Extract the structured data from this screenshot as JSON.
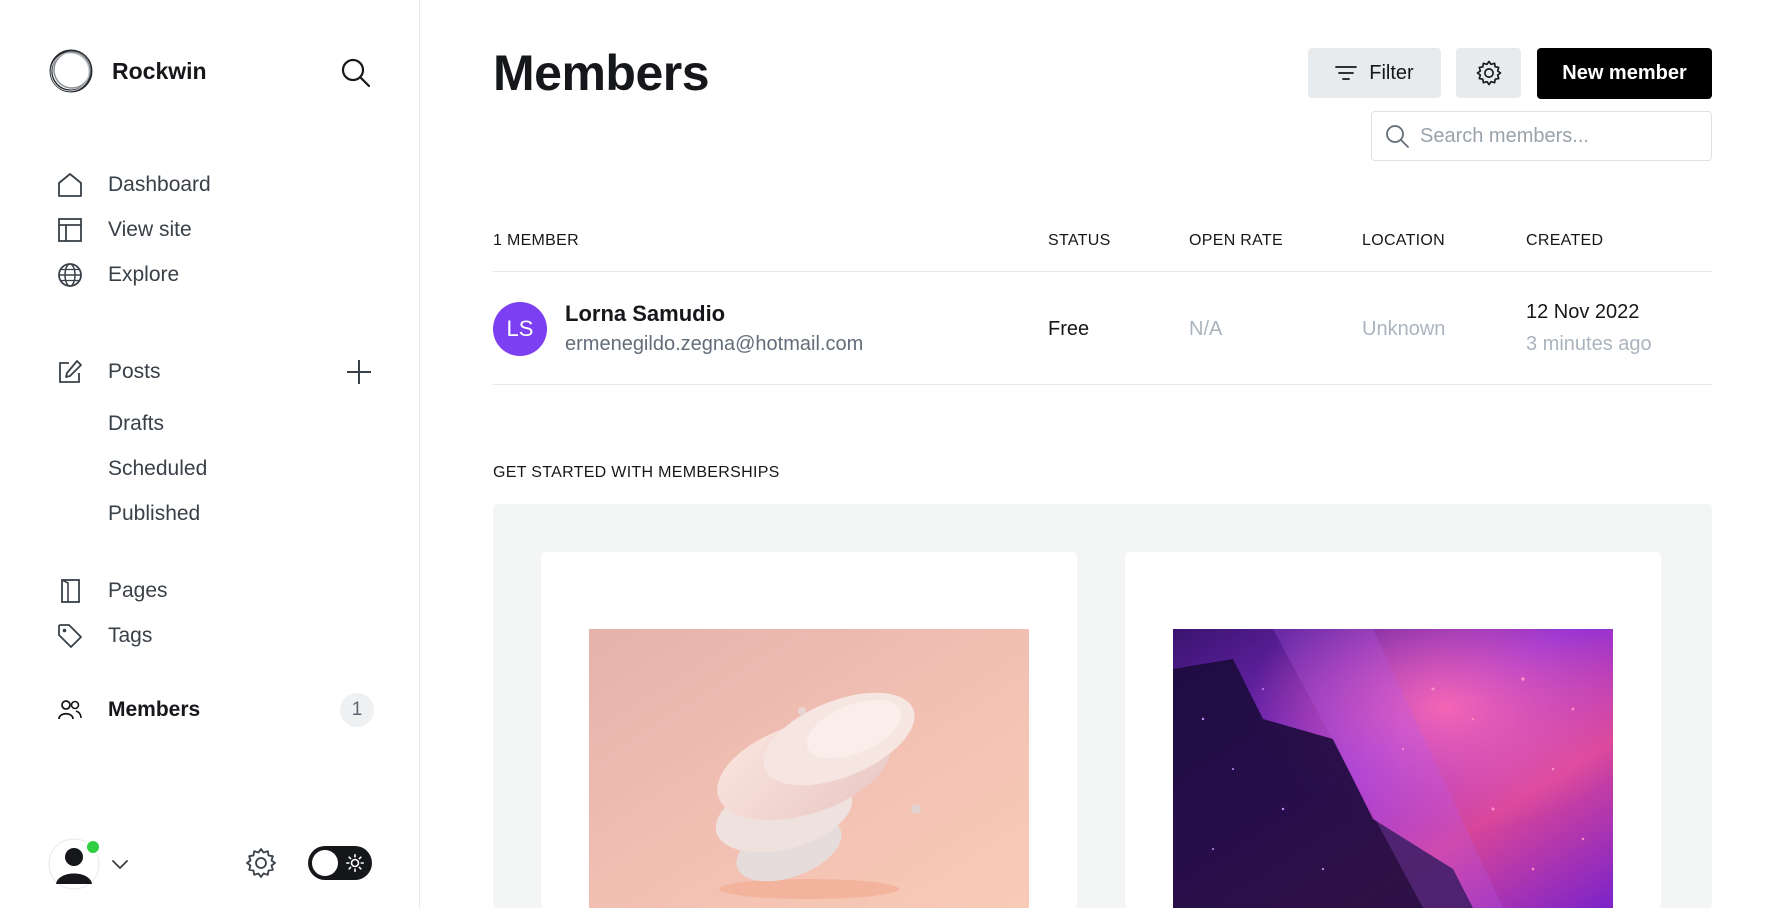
{
  "sidebar": {
    "brand_name": "Rockwin",
    "nav": [
      {
        "label": "Dashboard",
        "icon": "home-icon"
      },
      {
        "label": "View site",
        "icon": "layout-icon"
      },
      {
        "label": "Explore",
        "icon": "globe-icon"
      }
    ],
    "posts": {
      "label": "Posts",
      "icon": "pencil-square-icon",
      "sub": [
        "Drafts",
        "Scheduled",
        "Published"
      ]
    },
    "nav2": [
      {
        "label": "Pages",
        "icon": "page-icon"
      },
      {
        "label": "Tags",
        "icon": "tag-icon"
      },
      {
        "label": "Members",
        "icon": "users-icon",
        "count": "1"
      }
    ]
  },
  "header": {
    "title": "Members",
    "filter_label": "Filter",
    "new_member_label": "New member",
    "search_placeholder": "Search members..."
  },
  "table": {
    "columns": [
      "1 MEMBER",
      "STATUS",
      "OPEN RATE",
      "LOCATION",
      "CREATED"
    ],
    "rows": [
      {
        "initials": "LS",
        "name": "Lorna Samudio",
        "email": "ermenegildo.zegna@hotmail.com",
        "status": "Free",
        "open_rate": "N/A",
        "location": "Unknown",
        "created_date": "12 Nov 2022",
        "created_ago": "3 minutes ago"
      }
    ]
  },
  "get_started": {
    "title": "GET STARTED WITH MEMBERSHIPS"
  },
  "colors": {
    "accent_avatar": "#7c3ff1",
    "online": "#30cf43",
    "primary_button": "#000000"
  }
}
